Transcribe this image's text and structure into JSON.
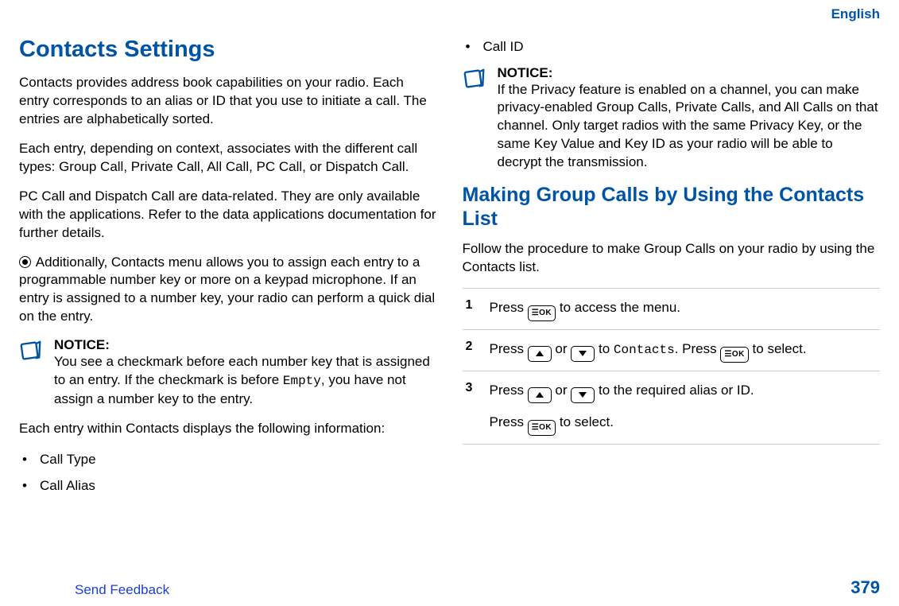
{
  "lang": "English",
  "footer": {
    "feedback": "Send Feedback",
    "page": "379"
  },
  "left": {
    "h1": "Contacts Settings",
    "p1": "Contacts provides address book capabilities on your radio. Each entry corresponds to an alias or ID that you use to initiate a call. The entries are alphabetically sorted.",
    "p2": "Each entry, depending on context, associates with the different call types: Group Call, Private Call, All Call, PC Call, or Dispatch Call.",
    "p3": "PC Call and Dispatch Call are data-related. They are only available with the applications. Refer to the data applications documentation for further details.",
    "p4": " Additionally, Contacts menu allows you to assign each entry to a programmable number key or more on a keypad microphone. If an entry is assigned to a number key, your radio can perform a quick dial on the entry.",
    "notice_title": "NOTICE:",
    "notice_a": "You see a checkmark before each number key that is assigned to an entry. If the checkmark is before ",
    "notice_empty": "Empty",
    "notice_b": ", you have not assign a number key to the entry.",
    "p5": "Each entry within Contacts displays the following information:",
    "bullets": [
      "Call Type",
      "Call Alias"
    ]
  },
  "right": {
    "bullets": [
      "Call ID"
    ],
    "notice_title": "NOTICE:",
    "notice_text": "If the Privacy feature is enabled on a channel, you can make privacy-enabled Group Calls, Private Calls, and All Calls on that channel. Only target radios with the same Privacy Key, or the same Key Value and Key ID as your radio will be able to decrypt the transmission.",
    "h2": "Making Group Calls by Using the Contacts List",
    "intro": "Follow the procedure to make Group Calls on your radio by using the Contacts list.",
    "steps": {
      "s1a": "Press ",
      "s1b": " to access the menu.",
      "s2a": "Press ",
      "s2b": " or ",
      "s2c": " to ",
      "s2_contacts": "Contacts",
      "s2d": ". Press ",
      "s2e": " to select.",
      "s3a": "Press ",
      "s3b": " or ",
      "s3c": " to the required alias or ID.",
      "s3d": "Press ",
      "s3e": " to select."
    },
    "ok_label": "OK"
  }
}
